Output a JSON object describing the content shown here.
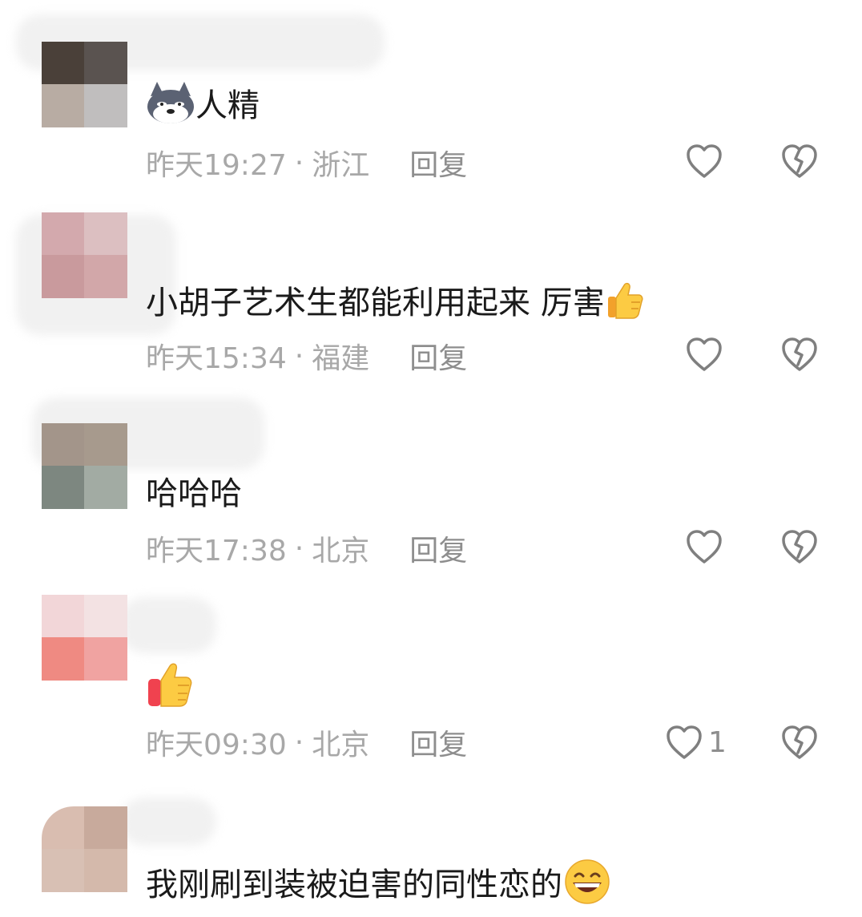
{
  "comments": [
    {
      "text": "人精",
      "leading_emoji": "husky-dog-emoji",
      "time": "昨天19:27",
      "separator": "·",
      "location": "浙江",
      "reply_label": "回复",
      "like_count": "",
      "avatar_colors": [
        "#4a4039",
        "#5a5350",
        "#b8aca3",
        "#c0bebe"
      ]
    },
    {
      "text": "小胡子艺术生都能利用起来 厉害",
      "trailing_emoji": "thumbs-up-emoji",
      "time": "昨天15:34",
      "separator": "·",
      "location": "福建",
      "reply_label": "回复",
      "like_count": "",
      "avatar_colors": [
        "#d3a9ad",
        "#dcbfc1",
        "#c99a9d",
        "#d2a7a9"
      ]
    },
    {
      "text": "哈哈哈",
      "time": "昨天17:38",
      "separator": "·",
      "location": "北京",
      "reply_label": "回复",
      "like_count": "",
      "avatar_colors": [
        "#a3958a",
        "#a79a8d",
        "#7d8780",
        "#a2aba3"
      ]
    },
    {
      "text": "",
      "leading_emoji": "thumbs-up-emoji",
      "time": "昨天09:30",
      "separator": "·",
      "location": "北京",
      "reply_label": "回复",
      "like_count": "1",
      "avatar_colors": [
        "#f2d6d8",
        "#f3e2e3",
        "#ef8a82",
        "#f0a3a1"
      ]
    },
    {
      "text": "我刚刷到装被迫害的同性恋的",
      "trailing_emoji": "grinning-face-emoji",
      "avatar_colors": [
        "#d9bdb0",
        "#c8aa9c",
        "#d8c0b4",
        "#d4b9ab"
      ]
    }
  ],
  "icons": {
    "like": "heart-outline-icon",
    "dislike": "broken-heart-outline-icon"
  },
  "colors": {
    "meta_text": "#a8a8a8",
    "reply_text": "#8e8e8e",
    "icon_stroke": "#7f7f7f",
    "body_text": "#1a1a1a"
  }
}
